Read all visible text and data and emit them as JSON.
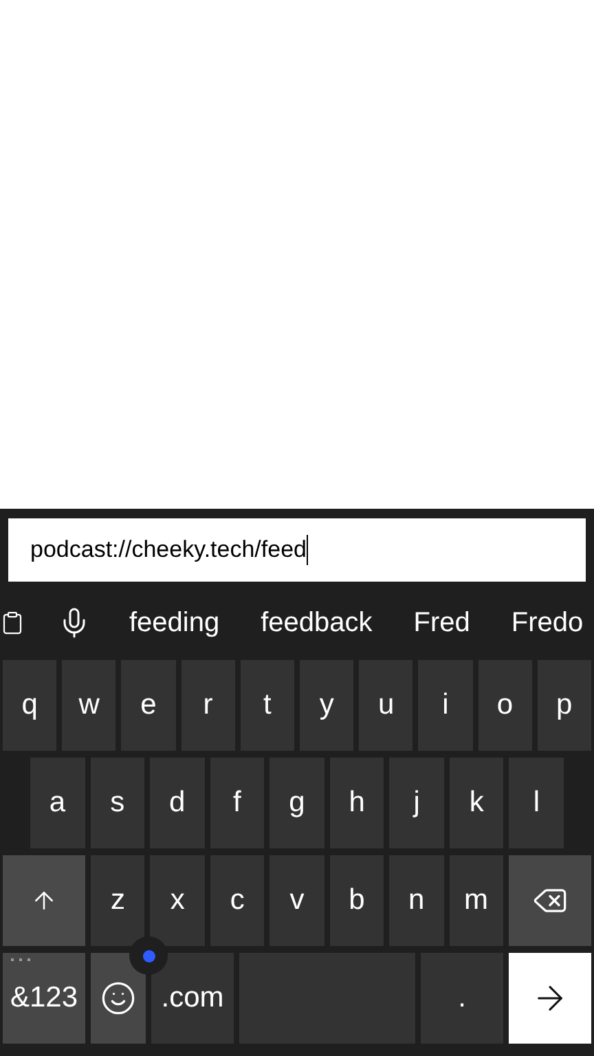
{
  "input": {
    "value": "podcast://cheeky.tech/feed"
  },
  "suggestions": [
    "feeding",
    "feedback",
    "Fred",
    "Fredo"
  ],
  "rows": [
    [
      {
        "kind": "char",
        "label": "q"
      },
      {
        "kind": "char",
        "label": "w"
      },
      {
        "kind": "char",
        "label": "e"
      },
      {
        "kind": "char",
        "label": "r"
      },
      {
        "kind": "char",
        "label": "t"
      },
      {
        "kind": "char",
        "label": "y"
      },
      {
        "kind": "char",
        "label": "u"
      },
      {
        "kind": "char",
        "label": "i"
      },
      {
        "kind": "char",
        "label": "o"
      },
      {
        "kind": "char",
        "label": "p"
      }
    ],
    [
      {
        "kind": "char",
        "label": "a"
      },
      {
        "kind": "char",
        "label": "s"
      },
      {
        "kind": "char",
        "label": "d"
      },
      {
        "kind": "char",
        "label": "f"
      },
      {
        "kind": "char",
        "label": "g"
      },
      {
        "kind": "char",
        "label": "h"
      },
      {
        "kind": "char",
        "label": "j"
      },
      {
        "kind": "char",
        "label": "k"
      },
      {
        "kind": "char",
        "label": "l"
      }
    ],
    [
      {
        "kind": "shift"
      },
      {
        "kind": "char",
        "label": "z"
      },
      {
        "kind": "char",
        "label": "x"
      },
      {
        "kind": "char",
        "label": "c"
      },
      {
        "kind": "char",
        "label": "v"
      },
      {
        "kind": "char",
        "label": "b"
      },
      {
        "kind": "char",
        "label": "n"
      },
      {
        "kind": "char",
        "label": "m"
      },
      {
        "kind": "backspace"
      }
    ],
    [
      {
        "kind": "symbols",
        "label": "&123"
      },
      {
        "kind": "emoji"
      },
      {
        "kind": "char",
        "label": ".com"
      },
      {
        "kind": "space"
      },
      {
        "kind": "char",
        "label": "."
      },
      {
        "kind": "enter"
      }
    ]
  ]
}
